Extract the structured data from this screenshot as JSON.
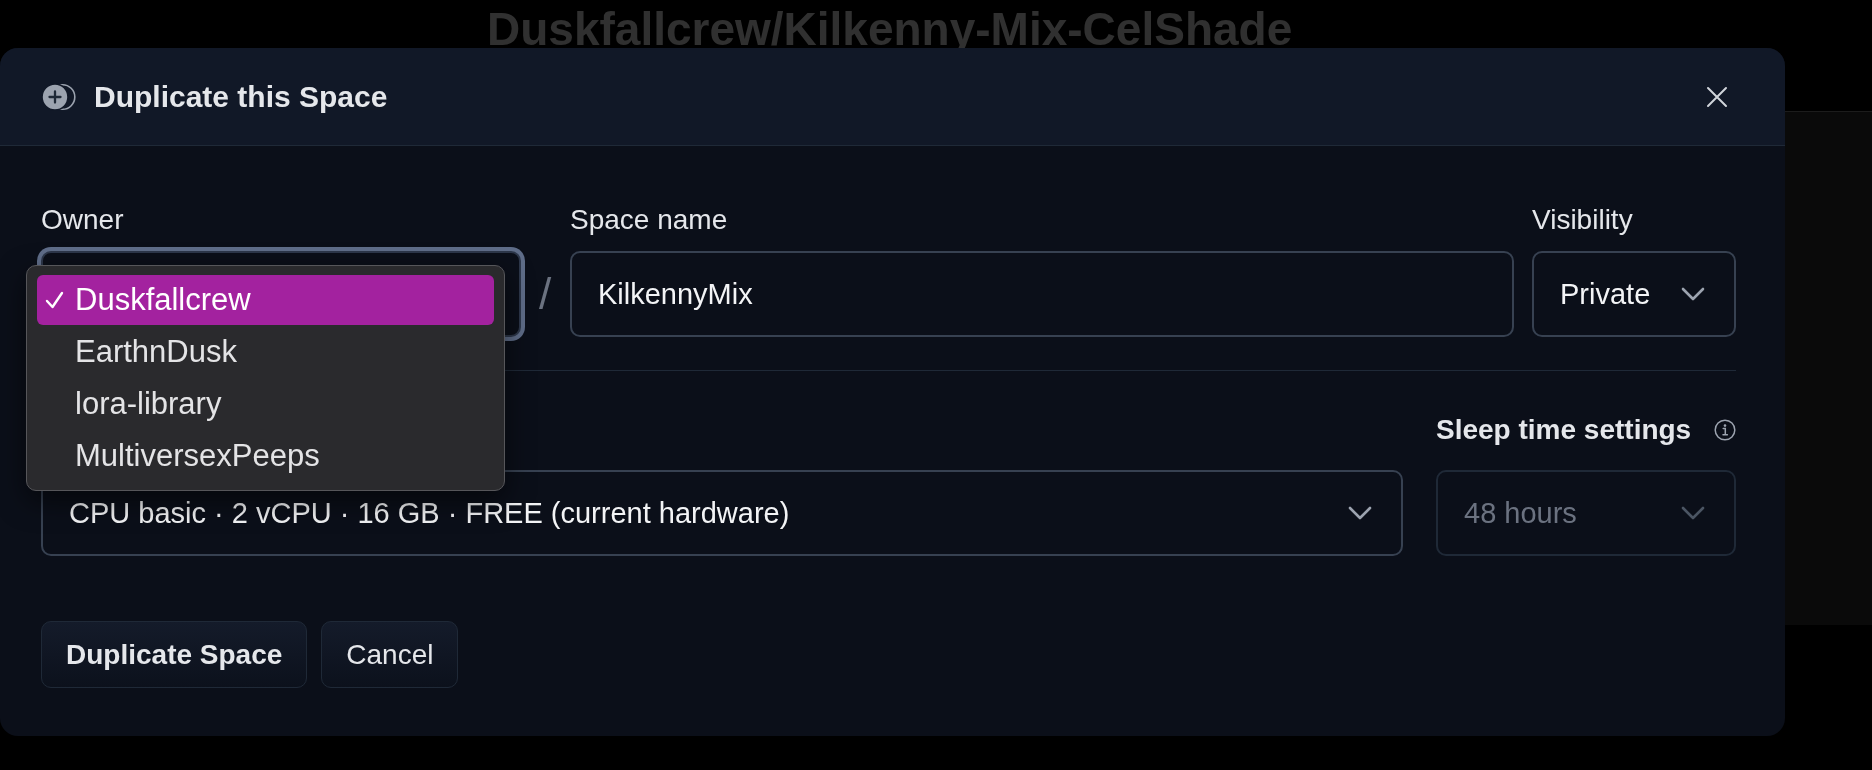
{
  "page_title": "Duskfallcrew/Kilkenny-Mix-CelShade",
  "dialog": {
    "title": "Duplicate this Space",
    "owner": {
      "label": "Owner",
      "focused": true,
      "menu_items": [
        {
          "label": "Duskfallcrew",
          "selected": true
        },
        {
          "label": "EarthnDusk",
          "selected": false
        },
        {
          "label": "lora-library",
          "selected": false
        },
        {
          "label": "MultiversexPeeps",
          "selected": false
        }
      ]
    },
    "separator": "/",
    "space_name": {
      "label": "Space name",
      "value": "KilkennyMix"
    },
    "visibility": {
      "label": "Visibility",
      "value": "Private"
    },
    "hardware": {
      "value": "CPU basic · 2 vCPU · 16 GB · FREE (current hardware)"
    },
    "sleep_time": {
      "label": "Sleep time settings",
      "value": "48 hours",
      "disabled": true
    },
    "buttons": [
      {
        "label": "Duplicate Space",
        "kind": "primary"
      },
      {
        "label": "Cancel",
        "kind": "secondary"
      }
    ]
  }
}
